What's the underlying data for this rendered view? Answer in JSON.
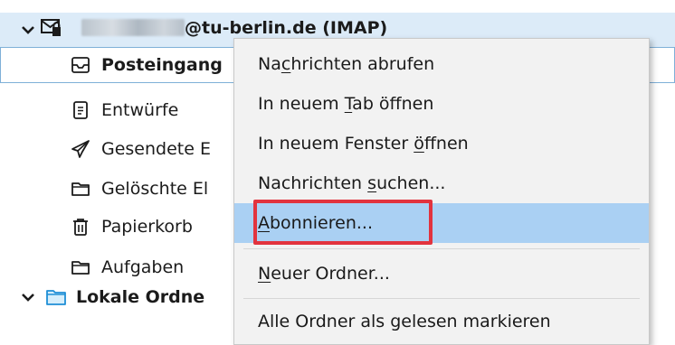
{
  "account": {
    "name_visible": "@tu-berlin.de (IMAP)"
  },
  "folders": [
    {
      "label": "Posteingang",
      "icon": "inbox-icon"
    },
    {
      "label": "Entwürfe",
      "icon": "drafts-icon"
    },
    {
      "label": "Gesendete E",
      "icon": "sent-icon"
    },
    {
      "label": "Gelöschte El",
      "icon": "folder-icon"
    },
    {
      "label": "Papierkorb",
      "icon": "trash-icon"
    },
    {
      "label": "Aufgaben",
      "icon": "folder-icon"
    }
  ],
  "local_folders": {
    "label": "Lokale Ordne",
    "icon": "folder-icon"
  },
  "context_menu": {
    "items": [
      {
        "pre": "Na",
        "key": "c",
        "post": "hrichten abrufen"
      },
      {
        "pre": "In neuem ",
        "key": "T",
        "post": "ab öffnen"
      },
      {
        "pre": "In neuem Fenster ",
        "key": "ö",
        "post": "ffnen"
      },
      {
        "pre": "Nachrichten ",
        "key": "s",
        "post": "uchen..."
      },
      {
        "pre": "",
        "key": "A",
        "post": "bonnieren..."
      },
      {
        "pre": "",
        "key": "N",
        "post": "euer Ordner..."
      },
      {
        "pre": "Alle Ordner als gelesen markieren",
        "key": "",
        "post": ""
      }
    ]
  },
  "colors": {
    "account_row_bg": "#dcebf8",
    "menu_hover": "#aad0f3",
    "highlight_border": "#e2333e"
  }
}
